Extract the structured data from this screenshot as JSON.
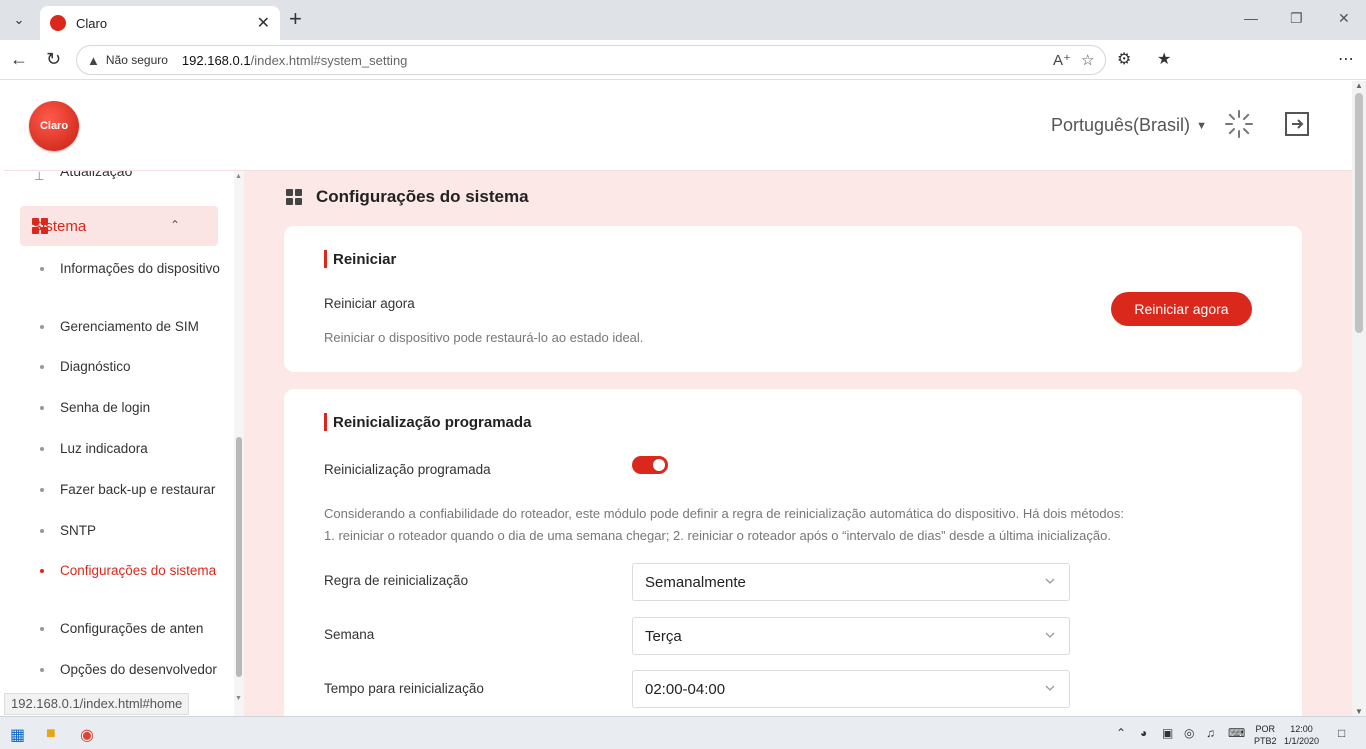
{
  "browser": {
    "tab_title": "Claro",
    "favicon_text": "Claro",
    "insecure_label": "Não seguro",
    "url_host": "192.168.0.1",
    "url_path": "/index.html#system_setting",
    "status_url": "192.168.0.1/index.html#home"
  },
  "header": {
    "logo_text": "Claro",
    "language": "Português(Brasil)"
  },
  "sidebar": {
    "partial_item": "Atualização",
    "section": "Sistema",
    "items": [
      "Informações do dispositivo",
      "Gerenciamento de SIM",
      "Diagnóstico",
      "Senha de login",
      "Luz indicadora",
      "Fazer back-up e restaurar",
      "SNTP",
      "Configurações do sistema",
      "Configurações de anten",
      "Opções do desenvolvedor"
    ]
  },
  "main": {
    "page_title": "Configurações do sistema",
    "restart": {
      "title": "Reiniciar",
      "label": "Reiniciar agora",
      "description": "Reiniciar o dispositivo pode restaurá-lo ao estado ideal.",
      "button": "Reiniciar agora"
    },
    "scheduled": {
      "title": "Reinicialização programada",
      "toggle_label": "Reinicialização programada",
      "toggle_on": true,
      "description_line1": "Considerando a confiabilidade do roteador, este módulo pode definir a regra de reinicialização automática do dispositivo. Há dois métodos:",
      "description_line2": "1. reiniciar o roteador quando o dia de uma semana chegar; 2. reiniciar o roteador após o “intervalo de dias” desde a última inicialização.",
      "rule_label": "Regra de reinicialização",
      "rule_value": "Semanalmente",
      "week_label": "Semana",
      "week_value": "Terça",
      "time_label": "Tempo para reinicialização",
      "time_value": "02:00-04:00"
    }
  },
  "taskbar": {
    "lang_top": "POR",
    "lang_bottom": "PTB2",
    "time": "12:00",
    "date": "1/1/2020"
  },
  "colors": {
    "brand": "#da291c",
    "content_bg": "#fde8e8"
  }
}
